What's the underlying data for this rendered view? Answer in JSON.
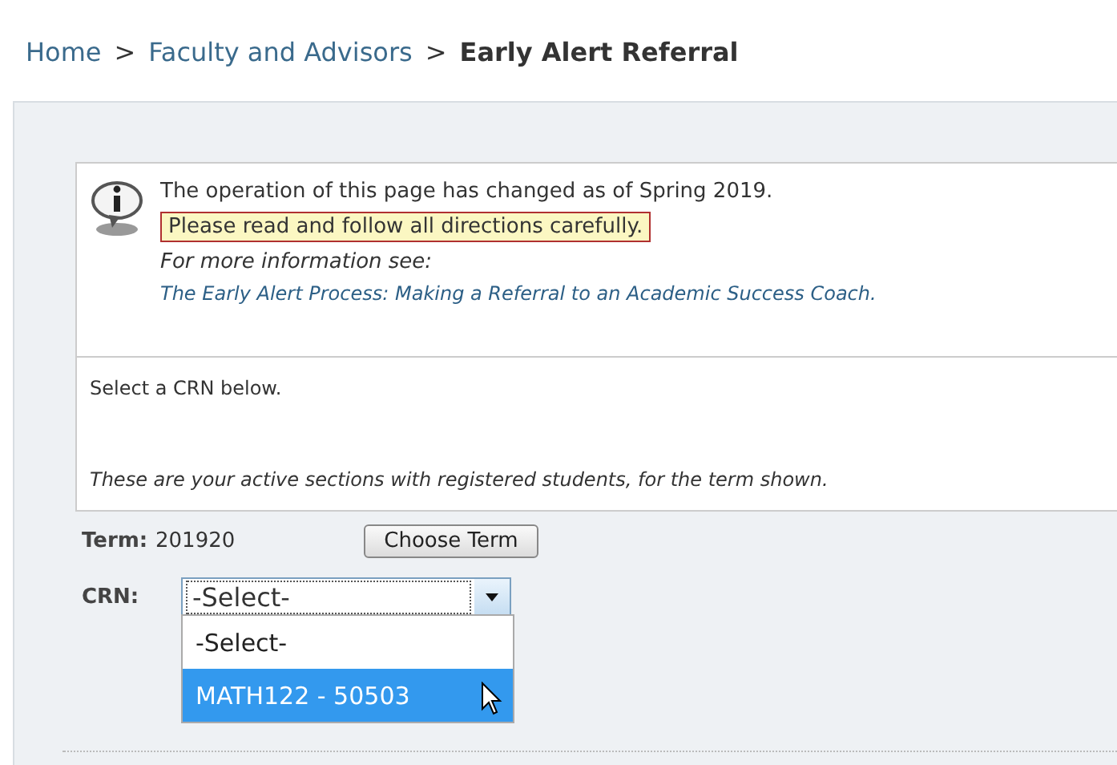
{
  "breadcrumb": [
    {
      "label": "Home",
      "kind": "link"
    },
    {
      "label": ">",
      "kind": "separator"
    },
    {
      "label": "Faculty and Advisors",
      "kind": "link"
    },
    {
      "label": ">",
      "kind": "separator"
    },
    {
      "label": "Early Alert Referral",
      "kind": "current"
    }
  ],
  "notice": {
    "line": "The operation of this page has changed as of Spring 2019.",
    "highlight": "Please read and follow all directions carefully.",
    "more": "For more information see:",
    "link": "The Early Alert Process: Making a Referral to an Academic Success Coach."
  },
  "instructions": {
    "line": "Select a CRN below.",
    "note": "These are your active sections with registered students, for the term shown."
  },
  "term": {
    "label": "Term:",
    "value": "201920",
    "button": "Choose Term"
  },
  "crn": {
    "label": "CRN:",
    "value": "-Select-",
    "expanded": true,
    "options": [
      {
        "label": "-Select-",
        "highlighted": false
      },
      {
        "label": "MATH122 - 50503",
        "highlighted": true
      }
    ]
  }
}
